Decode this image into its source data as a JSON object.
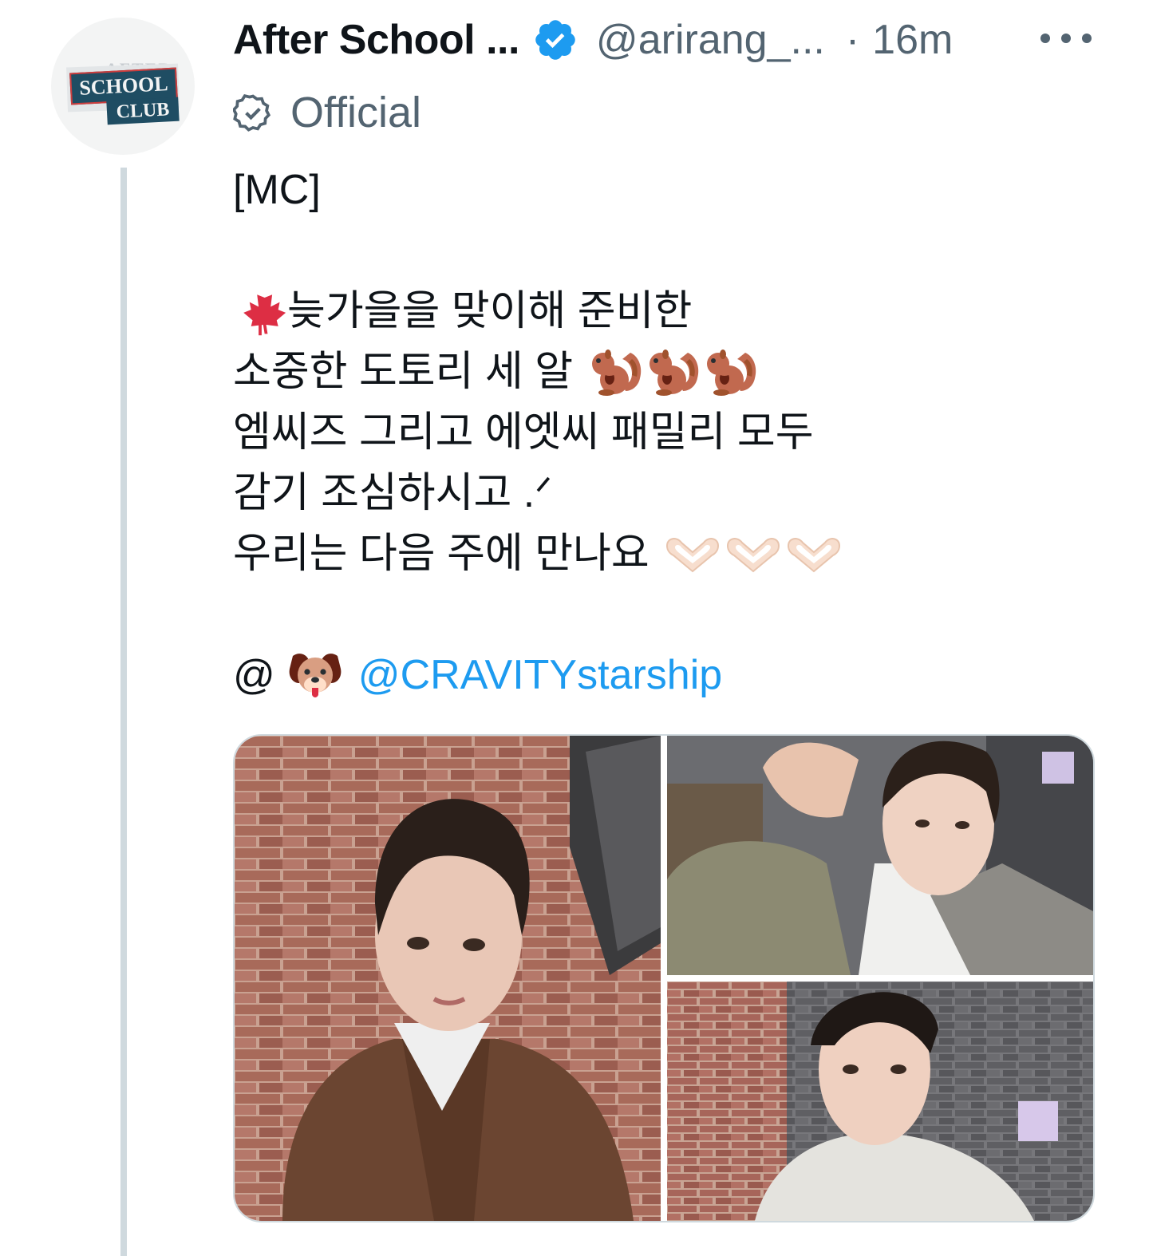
{
  "account": {
    "display_name": "After School ...",
    "handle": "@arirang_...",
    "separator": "·",
    "timestamp": "16m",
    "label": "Official",
    "avatar_text_top": "AFTER",
    "avatar_text_mid": "SCHOOL",
    "avatar_text_bot": "CLUB"
  },
  "tweet": {
    "line1": "[MC]",
    "line2": "늦가을을 맞이해 준비한",
    "line3": "소중한 도토리 세 알",
    "line4": "엠씨즈 그리고 에엣씨 패밀리 모두",
    "line5": "감기 조심하시고 .ᐟ",
    "line6": "우리는 다음 주에 만나요",
    "mention_prefix": "@",
    "mention": "@CRAVITYstarship"
  },
  "icons": {
    "verified": "verified-badge-icon",
    "official": "official-badge-icon",
    "more": "more-options-icon",
    "maple": "maple-leaf-emoji",
    "chipmunk": "chipmunk-emoji",
    "heart_hands": "heart-hands-emoji",
    "dog": "dog-face-emoji"
  },
  "colors": {
    "link": "#1d9bf0",
    "verified": "#1d9bf0",
    "secondary_text": "#536471",
    "thread_line": "#cfd9de"
  }
}
